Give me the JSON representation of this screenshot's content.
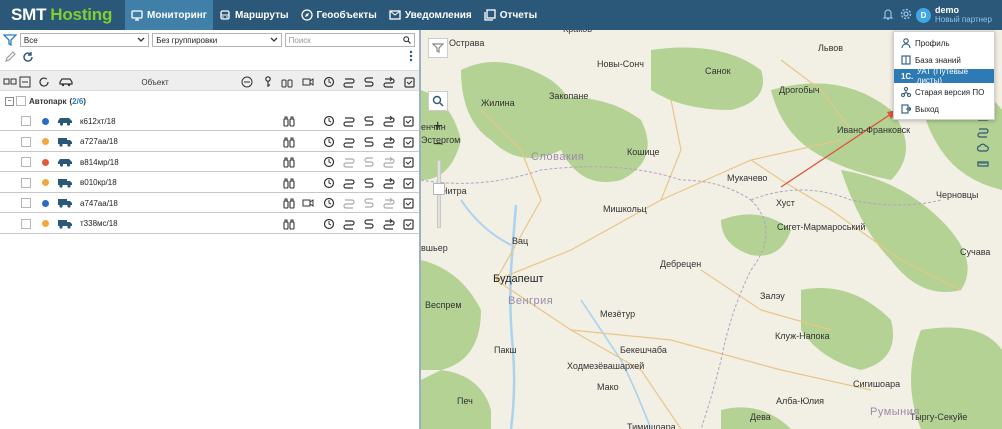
{
  "brand": {
    "part1": "SMT",
    "part2": "Hosting"
  },
  "nav": [
    {
      "label": "Мониторинг",
      "active": true
    },
    {
      "label": "Маршруты"
    },
    {
      "label": "Геообъекты"
    },
    {
      "label": "Уведомления"
    },
    {
      "label": "Отчеты"
    }
  ],
  "user": {
    "avatar_letter": "D",
    "name": "demo",
    "role": "Новый партнер"
  },
  "filters": {
    "status": "Все",
    "grouping": "Без группировки",
    "search_placeholder": "Поиск"
  },
  "table": {
    "column_object": "Объект"
  },
  "group": {
    "name": "Автопарк",
    "count_open": "(",
    "count_value": "2/6",
    "count_close": ")"
  },
  "vehicles": [
    {
      "plate": "к612хт/18",
      "status_color": "#2a6ac7",
      "vehicle_icon": "car-icon"
    },
    {
      "plate": "а727аа/18",
      "status_color": "#f0a838",
      "vehicle_icon": "truck-icon"
    },
    {
      "plate": "в814мр/18",
      "status_color": "#e15a3e",
      "vehicle_icon": "car-icon"
    },
    {
      "plate": "в010кр/18",
      "status_color": "#f0a838",
      "vehicle_icon": "truck-icon"
    },
    {
      "plate": "а747аа/18",
      "status_color": "#2a6ac7",
      "vehicle_icon": "truck-icon"
    },
    {
      "plate": "т338мс/18",
      "status_color": "#f0a838",
      "vehicle_icon": "truck-icon"
    }
  ],
  "menu": [
    {
      "label": "Профиль",
      "icon": "user-icon"
    },
    {
      "label": "База знаний",
      "icon": "book-icon"
    },
    {
      "label": "УАТ (Путевые листы)",
      "icon": "1c-icon",
      "active": true
    },
    {
      "label": "Старая версия ПО",
      "icon": "network-icon"
    },
    {
      "label": "Выход",
      "icon": "logout-icon"
    }
  ],
  "map": {
    "labels": [
      "Острава",
      "Краков",
      "Новы-Сонч",
      "Санок",
      "Львов",
      "Жилина",
      "Закопане",
      "Дрогобыч",
      "Ивано-Франковск",
      "Кошице",
      "Мукачево",
      "Мишкольц",
      "Хуст",
      "Нитра",
      "Сигет-Мармароський",
      "Вац",
      "Дебрецен",
      "Черновцы",
      "Сучава",
      "Эстергом",
      "Залэу",
      "Мезётур",
      "Клуж-Напока",
      "Пакш",
      "Бекешчаба",
      "Ходмезёвашархей",
      "Мако",
      "Сигишоара",
      "Печ",
      "Алба-Юлия",
      "Дева",
      "Тыргу-Секуйе",
      "Тимишоара",
      "енчин",
      "вшьер",
      "Веспрем"
    ],
    "cities": [
      "Будапешт"
    ],
    "regions": [
      "Словакия",
      "Венгрия",
      "Румыния"
    ],
    "zoom_in": "+",
    "zoom_out": "−"
  },
  "colors": {
    "topbar": "#2b5778",
    "active_tab": "#3f7fa8",
    "brand_green": "#7fd02e",
    "menu_active": "#2e7ab4",
    "forest": "#a9cd86",
    "water": "#a9d3f0"
  }
}
